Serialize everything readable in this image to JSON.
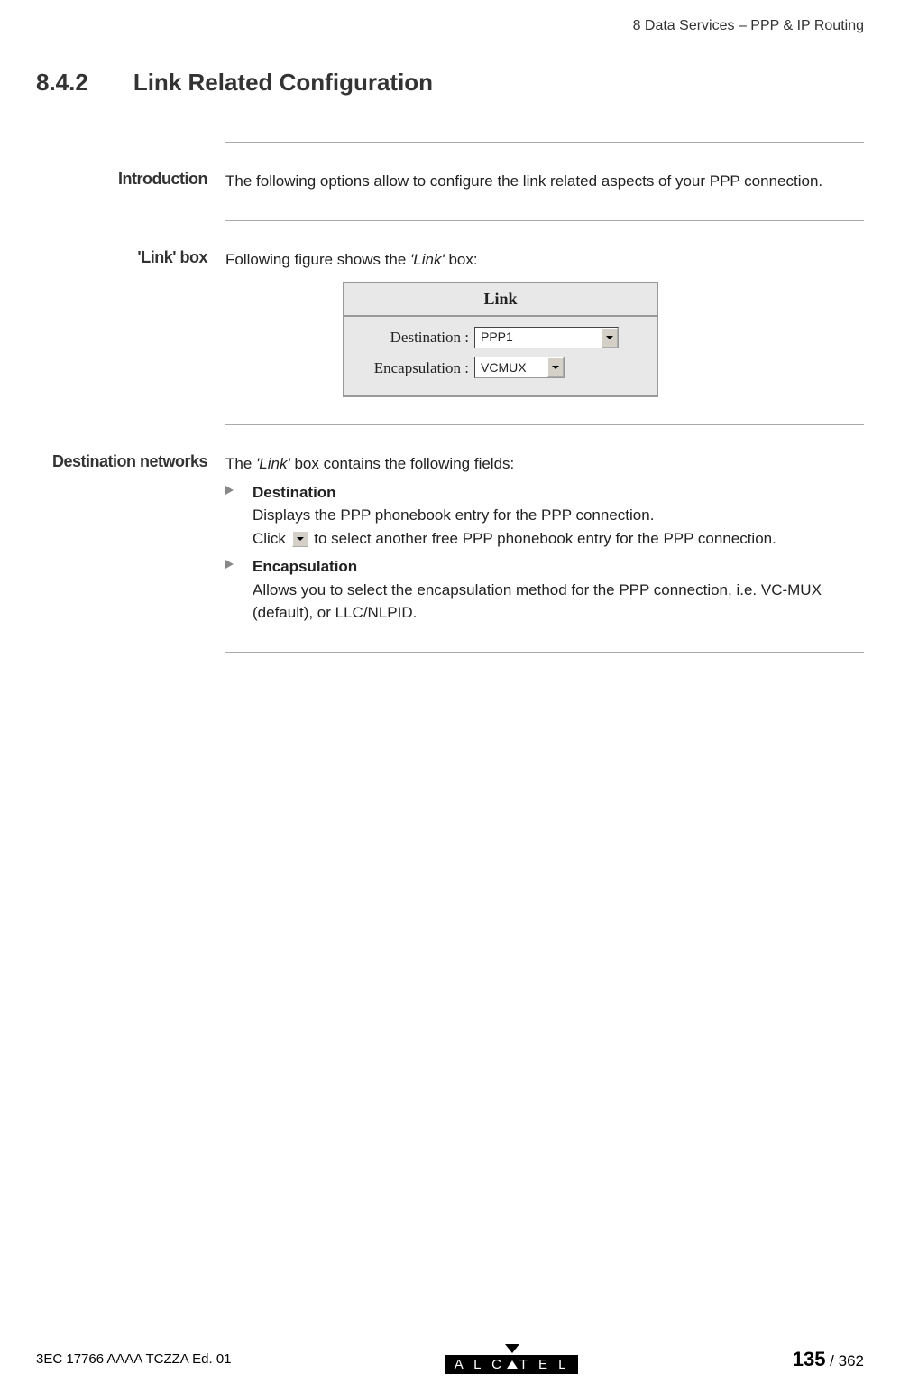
{
  "header": {
    "chapter_label": "8   Data Services – PPP & IP Routing"
  },
  "section": {
    "number": "8.4.2",
    "title": "Link Related Configuration"
  },
  "blocks": {
    "introduction": {
      "label": "Introduction",
      "text": "The following options allow to configure the link related aspects of your PPP connection."
    },
    "linkbox": {
      "label": "'Link' box",
      "intro_prefix": "Following figure shows the ",
      "intro_italic": "'Link'",
      "intro_suffix": " box:",
      "figure": {
        "title": "Link",
        "destination_label": "Destination :",
        "destination_value": "PPP1",
        "encapsulation_label": "Encapsulation :",
        "encapsulation_value": "VCMUX"
      }
    },
    "destnetworks": {
      "label": "Destination networks",
      "intro_prefix": "The ",
      "intro_italic": "'Link'",
      "intro_suffix": " box contains the following fields:",
      "items": [
        {
          "title": "Destination",
          "line1": "Displays the PPP phonebook entry for the PPP connection.",
          "line2_prefix": "Click ",
          "line2_suffix": " to select another free PPP phonebook entry for the PPP connection."
        },
        {
          "title": "Encapsulation",
          "line1": "Allows you to select the encapsulation method for the PPP connection, i.e. VC-MUX (default), or LLC/NLPID."
        }
      ]
    }
  },
  "footer": {
    "doc_ref": "3EC 17766 AAAA TCZZA Ed. 01",
    "logo_text_pre": "A L C",
    "logo_text_post": "T E L",
    "page_current": "135",
    "page_sep": " / ",
    "page_total": "362"
  }
}
